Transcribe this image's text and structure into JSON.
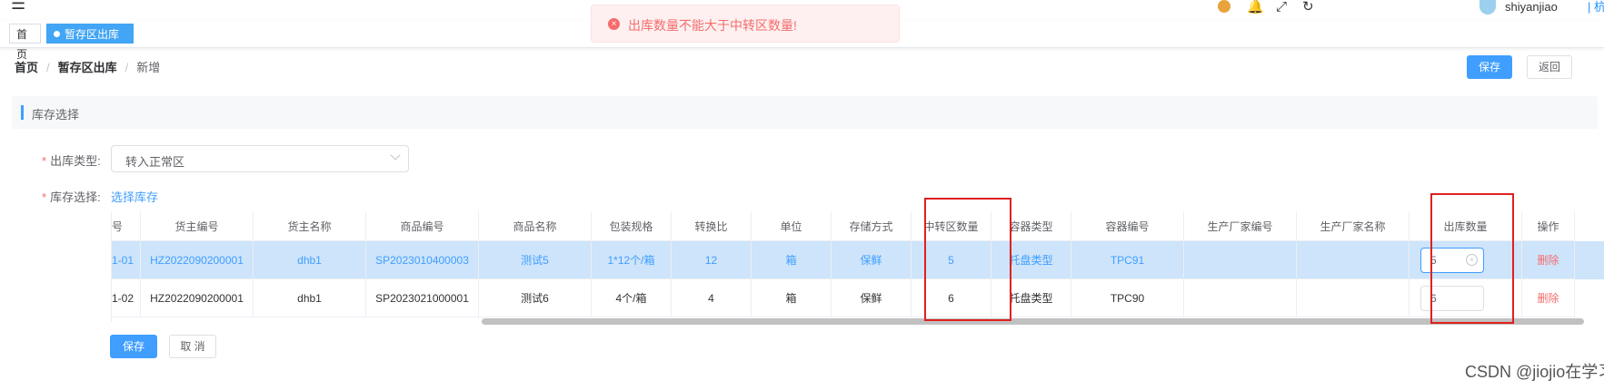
{
  "header": {
    "menu_icon": "hamburger-icon",
    "user": "shiyanjiao",
    "separator": "|",
    "warehouse": "杭州仓"
  },
  "tags": {
    "home": "首页",
    "active": "暂存区出库",
    "close": "×"
  },
  "toast": {
    "icon": "error-circle-icon",
    "text": "出库数量不能大于中转区数量!"
  },
  "breadcrumb": {
    "home": "首页",
    "parent": "暂存区出库",
    "current": "新增",
    "separator": "/"
  },
  "actions": {
    "save": "保存",
    "back": "返回"
  },
  "section": {
    "title": "库存选择"
  },
  "form": {
    "out_type_label": "出库类型:",
    "out_type_value": "转入正常区",
    "stock_label": "库存选择:",
    "stock_link": "选择库存",
    "required_mark": "*"
  },
  "table": {
    "columns": [
      "号",
      "货主编号",
      "货主名称",
      "商品编号",
      "商品名称",
      "包装规格",
      "转换比",
      "单位",
      "存储方式",
      "中转区数量",
      "容器类型",
      "容器编号",
      "生产厂家编号",
      "生产厂家名称",
      "出库数量",
      "操作"
    ],
    "rows": [
      [
        "1-01",
        "HZ2022090200001",
        "dhb1",
        "SP2023010400003",
        "测试5",
        "1*12个/箱",
        "12",
        "箱",
        "保鲜",
        "5",
        "托盘类型",
        "TPC91",
        "",
        "",
        "5",
        "删除"
      ],
      [
        "1-02",
        "HZ2022090200001",
        "dhb1",
        "SP2023021000001",
        "测试6",
        "4个/箱",
        "4",
        "箱",
        "保鲜",
        "6",
        "托盘类型",
        "TPC90",
        "",
        "",
        "6",
        "删除"
      ]
    ]
  },
  "footer": {
    "save": "保存",
    "cancel": "取 消"
  },
  "watermark": "CSDN @jiojio在学习勒",
  "colors": {
    "primary": "#409eff",
    "error": "#f56c6c",
    "highlight_row": "#cde4fa",
    "annotation": "#e02020"
  }
}
